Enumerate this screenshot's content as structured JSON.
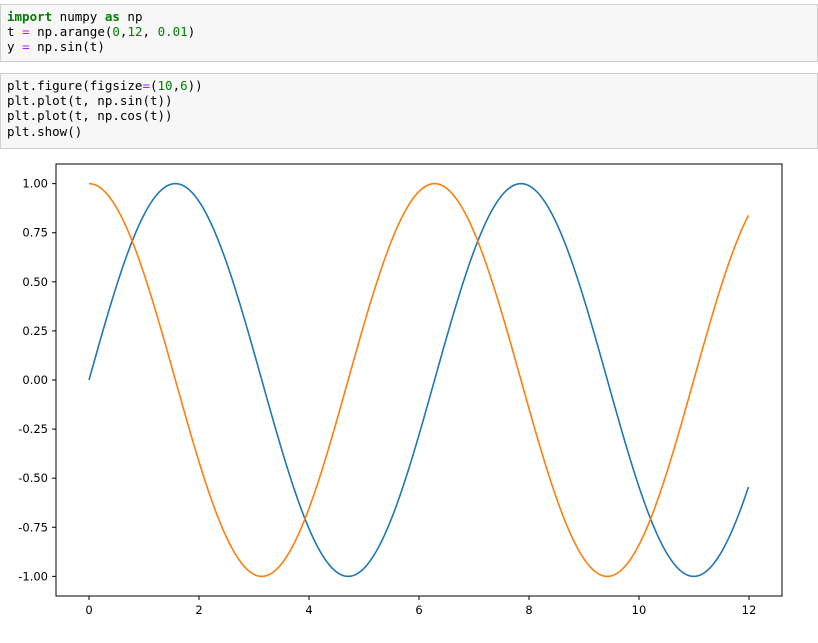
{
  "cells": [
    {
      "lines": [
        [
          {
            "t": "import",
            "c": "kw"
          },
          {
            "t": " numpy "
          },
          {
            "t": "as",
            "c": "kw"
          },
          {
            "t": " np"
          }
        ],
        [
          {
            "t": "t "
          },
          {
            "t": "=",
            "c": "op"
          },
          {
            "t": " np.arange("
          },
          {
            "t": "0",
            "c": "num"
          },
          {
            "t": ","
          },
          {
            "t": "12",
            "c": "num"
          },
          {
            "t": ", "
          },
          {
            "t": "0.01",
            "c": "num"
          },
          {
            "t": ")"
          }
        ],
        [
          {
            "t": "y "
          },
          {
            "t": "=",
            "c": "op"
          },
          {
            "t": " np.sin(t)"
          }
        ]
      ]
    },
    {
      "lines": [
        [
          {
            "t": "plt.figure(figsize"
          },
          {
            "t": "=",
            "c": "op"
          },
          {
            "t": "("
          },
          {
            "t": "10",
            "c": "num"
          },
          {
            "t": ","
          },
          {
            "t": "6",
            "c": "num"
          },
          {
            "t": "))"
          }
        ],
        [
          {
            "t": "plt.plot(t, np.sin(t))"
          }
        ],
        [
          {
            "t": "plt.plot(t, np.cos(t))"
          }
        ],
        [
          {
            "t": "plt.show()"
          }
        ]
      ]
    }
  ],
  "chart_data": {
    "type": "line",
    "title": "",
    "xlabel": "",
    "ylabel": "",
    "xlim": [
      -0.6,
      12.6
    ],
    "ylim": [
      -1.1,
      1.1
    ],
    "xticks": [
      0,
      2,
      4,
      6,
      8,
      10,
      12
    ],
    "xtick_labels": [
      "0",
      "2",
      "4",
      "6",
      "8",
      "10",
      "12"
    ],
    "yticks": [
      1.0,
      0.75,
      0.5,
      0.25,
      0.0,
      -0.25,
      -0.5,
      -0.75,
      -1.0
    ],
    "ytick_labels": [
      "1.00",
      "0.75",
      "0.50",
      "0.25",
      "0.00",
      "-0.25",
      "-0.50",
      "-0.75",
      "-1.00"
    ],
    "grid": false,
    "legend": "none",
    "x_range": [
      0,
      11.99
    ],
    "x_step": 0.01,
    "series": [
      {
        "function": "sin",
        "color": "#1f77b4"
      },
      {
        "function": "cos",
        "color": "#ff7f0e"
      }
    ]
  }
}
